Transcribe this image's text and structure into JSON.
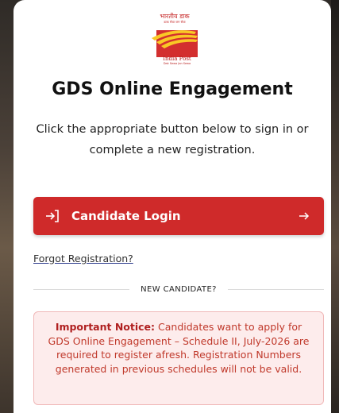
{
  "logo": {
    "hindi_name": "भारतीय डाक",
    "hindi_tagline": "डाक सेवा जन सेवा",
    "english_name": "India Post",
    "english_tagline": "Dak Sewa Jan Sewa"
  },
  "page": {
    "title": "GDS Online Engagement",
    "subtitle": "Click the appropriate button below to sign in or complete a new registration."
  },
  "login_button": {
    "label": "Candidate Login",
    "icon": "login-arrow-icon",
    "trailing_icon": "arrow-right-icon"
  },
  "forgot_link": {
    "label": "Forgot Registration?"
  },
  "divider": {
    "label": "NEW CANDIDATE?"
  },
  "notice": {
    "heading": "Important Notice:",
    "body": "Candidates want to apply for GDS Online Engagement – Schedule II, July-2026 are required to register afresh. Registration Numbers generated in previous schedules will not be valid."
  },
  "colors": {
    "primary": "#cf2a2a",
    "notice_bg": "#fdecec",
    "notice_text": "#c0392b"
  }
}
